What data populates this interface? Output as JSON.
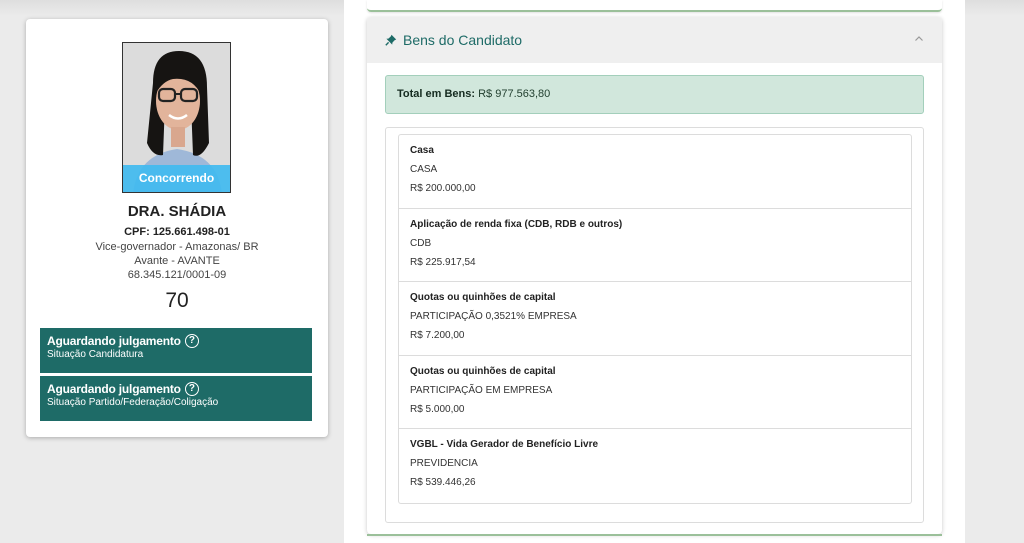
{
  "candidate": {
    "photo_badge": "Concorrendo",
    "name": "DRA. SHÁDIA",
    "cpf": "CPF: 125.661.498-01",
    "role": "Vice-governador - Amazonas/ BR",
    "party": "Avante - AVANTE",
    "cnpj": "68.345.121/0001-09",
    "number": "70",
    "status": [
      {
        "title": "Aguardando julgamento",
        "subtitle": "Situação Candidatura"
      },
      {
        "title": "Aguardando julgamento",
        "subtitle": "Situação Partido/Federação/Coligação"
      }
    ]
  },
  "assets": {
    "title": "Bens do Candidato",
    "total_label": "Total em Bens:",
    "total_value": "R$ 977.563,80",
    "items": [
      {
        "title": "Casa",
        "description": "CASA",
        "value": "R$ 200.000,00"
      },
      {
        "title": "Aplicação de renda fixa (CDB, RDB e outros)",
        "description": "CDB",
        "value": "R$ 225.917,54"
      },
      {
        "title": "Quotas ou quinhões de capital",
        "description": "PARTICIPAÇÃO 0,3521% EMPRESA",
        "value": "R$ 7.200,00"
      },
      {
        "title": "Quotas ou quinhões de capital",
        "description": "PARTICIPAÇÃO EM EMPRESA",
        "value": "R$ 5.000,00"
      },
      {
        "title": "VGBL - Vida Gerador de Benefício Livre",
        "description": "PREVIDENCIA",
        "value": "R$ 539.446,26"
      }
    ]
  },
  "icons": {
    "help": "question-circle-icon",
    "section": "thumbtack-icon",
    "collapse": "chevron-up-icon"
  },
  "colors": {
    "status_bg": "#1e6b67",
    "accent": "#1e6b67",
    "photo_badge": "#42baef",
    "total_bg": "#d1e7dc"
  }
}
